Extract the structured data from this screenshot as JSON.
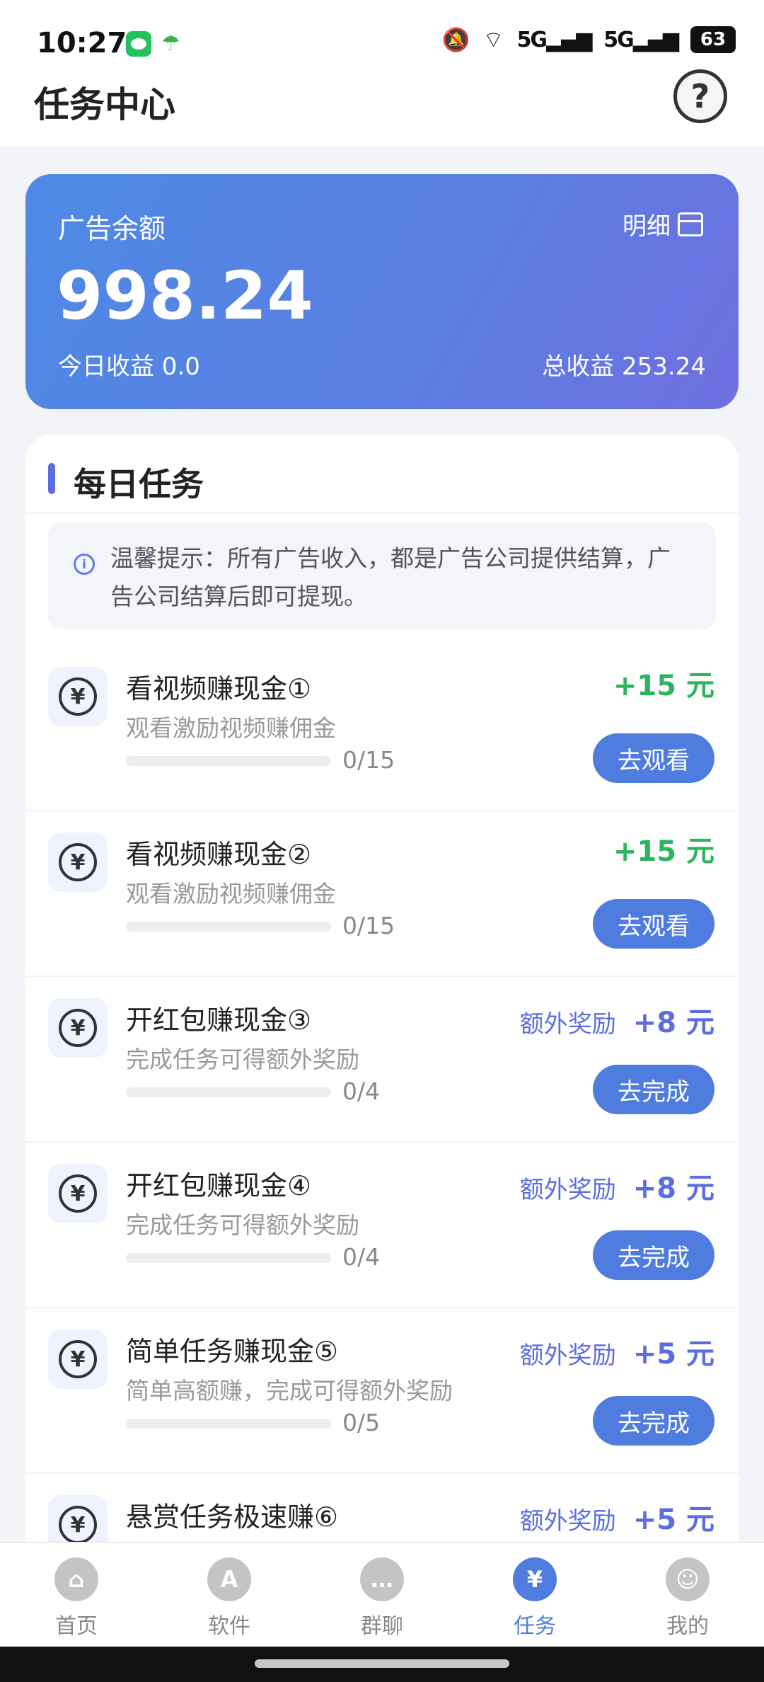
{
  "status_bar": {
    "time": "10:27",
    "network_1": "5G",
    "network_2": "5G",
    "battery": "63"
  },
  "header": {
    "title": "任务中心",
    "help_icon": "question-circle-icon"
  },
  "balance": {
    "label": "广告余额",
    "detail_label": "明细",
    "amount": "998.24",
    "today": "今日收益 0.0",
    "total": "总收益 253.24"
  },
  "daily_tasks": {
    "title": "每日任务",
    "tip": "温馨提示：所有广告收入，都是广告公司提供结算，广告公司结算后即可提现。",
    "tasks": [
      {
        "title": "看视频赚现金①",
        "desc": "观看激励视频赚佣金",
        "progress": "0/15",
        "reward": "+15 元",
        "button": "去观看"
      },
      {
        "title": "看视频赚现金②",
        "desc": "观看激励视频赚佣金",
        "progress": "0/15",
        "reward": "+15 元",
        "button": "去观看"
      },
      {
        "title": "开红包赚现金③",
        "desc": "完成任务可得额外奖励",
        "progress": "0/4",
        "extra_label": "额外奖励",
        "reward": "+8 元",
        "button": "去完成"
      },
      {
        "title": "开红包赚现金④",
        "desc": "完成任务可得额外奖励",
        "progress": "0/4",
        "extra_label": "额外奖励",
        "reward": "+8 元",
        "button": "去完成"
      },
      {
        "title": "简单任务赚现金⑤",
        "desc": "简单高额赚，完成可得额外奖励",
        "progress": "0/5",
        "extra_label": "额外奖励",
        "reward": "+5 元",
        "button": "去完成"
      },
      {
        "title": "悬赏任务极速赚⑥",
        "extra_label": "额外奖励",
        "reward": "+5 元"
      }
    ]
  },
  "bottom_nav": [
    {
      "label": "首页",
      "icon": "home-icon"
    },
    {
      "label": "软件",
      "icon": "app-store-icon"
    },
    {
      "label": "群聊",
      "icon": "chat-icon"
    },
    {
      "label": "任务",
      "icon": "yen-icon",
      "active": true
    },
    {
      "label": "我的",
      "icon": "user-icon"
    }
  ],
  "colors": {
    "accent": "#4f7ddf",
    "reward_green": "#2cb55e",
    "extra_purple": "#5b6ee0"
  }
}
